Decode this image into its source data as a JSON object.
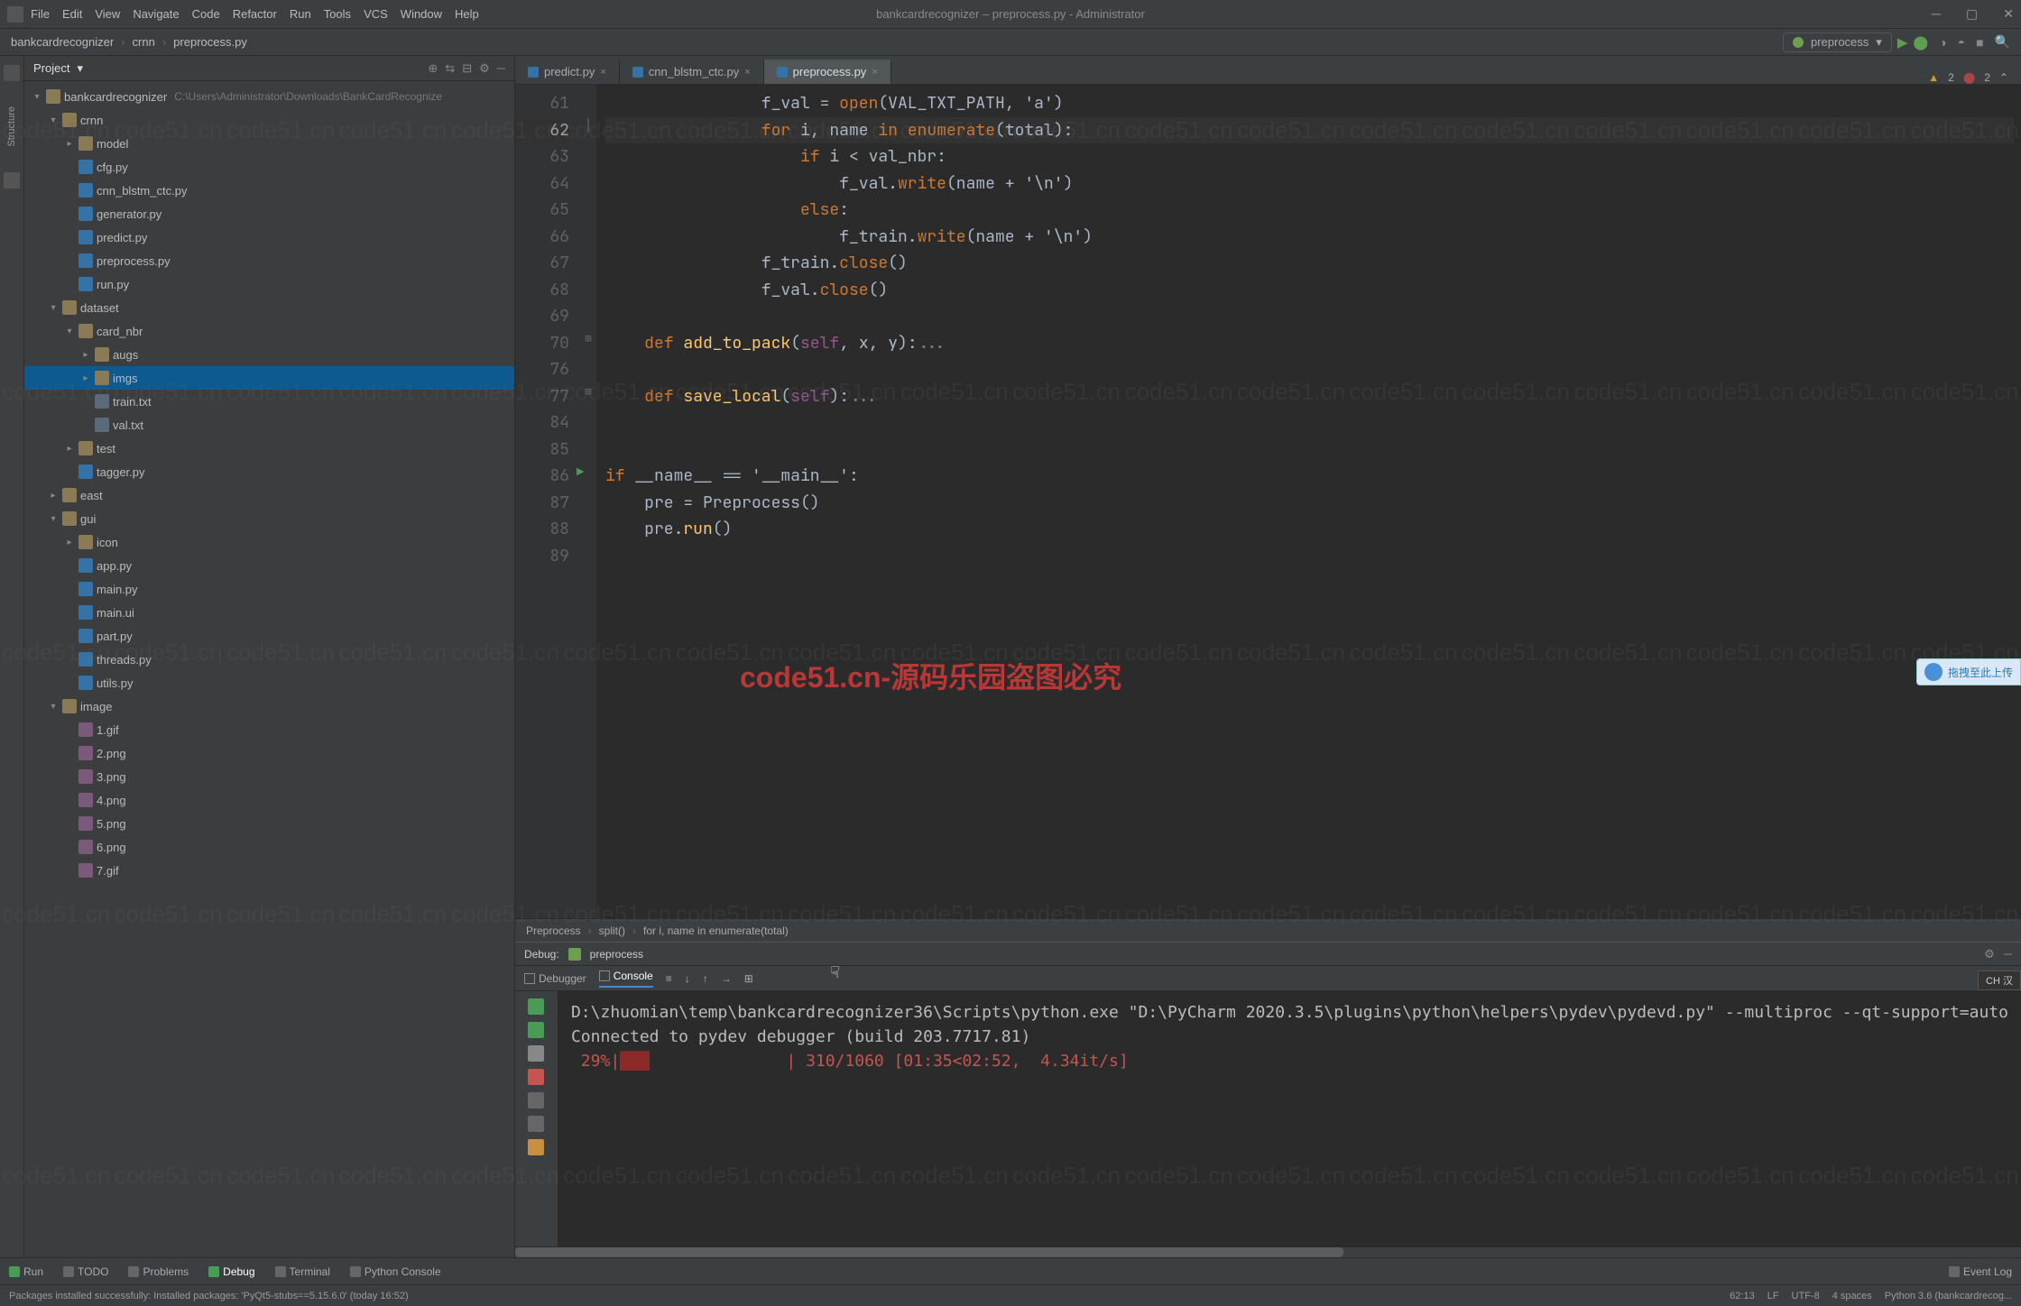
{
  "title": "bankcardrecognizer – preprocess.py - Administrator",
  "menus": [
    "File",
    "Edit",
    "View",
    "Navigate",
    "Code",
    "Refactor",
    "Run",
    "Tools",
    "VCS",
    "Window",
    "Help"
  ],
  "breadcrumb": [
    "bankcardrecognizer",
    "crnn",
    "preprocess.py"
  ],
  "run_config": "preprocess",
  "project_header": "Project",
  "project_root_label": "bankcardrecognizer",
  "project_root_path": "C:\\Users\\Administrator\\Downloads\\BankCardRecognize",
  "tree": {
    "crnn": {
      "model": {},
      "files": [
        "cfg.py",
        "cnn_blstm_ctc.py",
        "generator.py",
        "predict.py",
        "preprocess.py",
        "run.py"
      ]
    },
    "dataset": {
      "card_nbr": {
        "augs": {},
        "imgs": {},
        "files": [
          "train.txt",
          "val.txt"
        ]
      },
      "test": {},
      "files": [
        "tagger.py"
      ]
    },
    "east": {},
    "gui": {
      "icon": {},
      "files": [
        "app.py",
        "main.py",
        "main.ui",
        "part.py",
        "threads.py",
        "utils.py"
      ]
    },
    "image": {
      "files": [
        "1.gif",
        "2.png",
        "3.png",
        "4.png",
        "5.png",
        "6.png",
        "7.gif"
      ]
    }
  },
  "editor_tabs": [
    {
      "label": "predict.py",
      "active": false
    },
    {
      "label": "cnn_blstm_ctc.py",
      "active": false
    },
    {
      "label": "preprocess.py",
      "active": true
    }
  ],
  "inspection": {
    "warnings": "2",
    "weak": "2"
  },
  "code_lines": [
    {
      "n": 61,
      "txt": "                f_val = open(VAL_TXT_PATH, 'a')"
    },
    {
      "n": 62,
      "txt": "                for i, name in enumerate(total):",
      "hi": true
    },
    {
      "n": 63,
      "txt": "                    if i < val_nbr:"
    },
    {
      "n": 64,
      "txt": "                        f_val.write(name + '\\n')"
    },
    {
      "n": 65,
      "txt": "                    else:"
    },
    {
      "n": 66,
      "txt": "                        f_train.write(name + '\\n')"
    },
    {
      "n": 67,
      "txt": "                f_train.close()"
    },
    {
      "n": 68,
      "txt": "                f_val.close()"
    },
    {
      "n": 69,
      "txt": ""
    },
    {
      "n": 70,
      "txt": "    def add_to_pack(self, x, y):..."
    },
    {
      "n": 76,
      "txt": ""
    },
    {
      "n": 77,
      "txt": "    def save_local(self):..."
    },
    {
      "n": 84,
      "txt": ""
    },
    {
      "n": 85,
      "txt": ""
    },
    {
      "n": 86,
      "txt": "if __name__ == '__main__':",
      "run": true
    },
    {
      "n": 87,
      "txt": "    pre = Preprocess()"
    },
    {
      "n": 88,
      "txt": "    pre.run()"
    },
    {
      "n": 89,
      "txt": ""
    }
  ],
  "code_breadcrumb": [
    "Preprocess",
    "split()",
    "for i, name in enumerate(total)"
  ],
  "debug_title": "Debug:",
  "debug_config": "preprocess",
  "debug_tabs": [
    "Debugger",
    "Console"
  ],
  "console_lines": [
    "D:\\zhuomian\\temp\\bankcardrecognizer36\\Scripts\\python.exe \"D:\\PyCharm 2020.3.5\\plugins\\python\\helpers\\pydev\\pydevd.py\" --multiproc --qt-support=auto",
    "Connected to pydev debugger (build 203.7717.81)",
    " 29%|███              | 310/1060 [01:35<02:52,  4.34it/s]"
  ],
  "bottom_tools": [
    "Run",
    "TODO",
    "Problems",
    "Debug",
    "Terminal",
    "Python Console"
  ],
  "event_log": "Event Log",
  "status_msg": "Packages installed successfully: Installed packages: 'PyQt5-stubs==5.15.6.0' (today 16:52)",
  "status_right": [
    "62:13",
    "LF",
    "UTF-8",
    "4 spaces",
    "Python 3.6 (bankcardrecog..."
  ],
  "watermark": "code51.cn",
  "big_watermark": "code51.cn-源码乐园盗图必究",
  "cloud_badge": "拖拽至此上传",
  "ch_badge": "CH 汉"
}
